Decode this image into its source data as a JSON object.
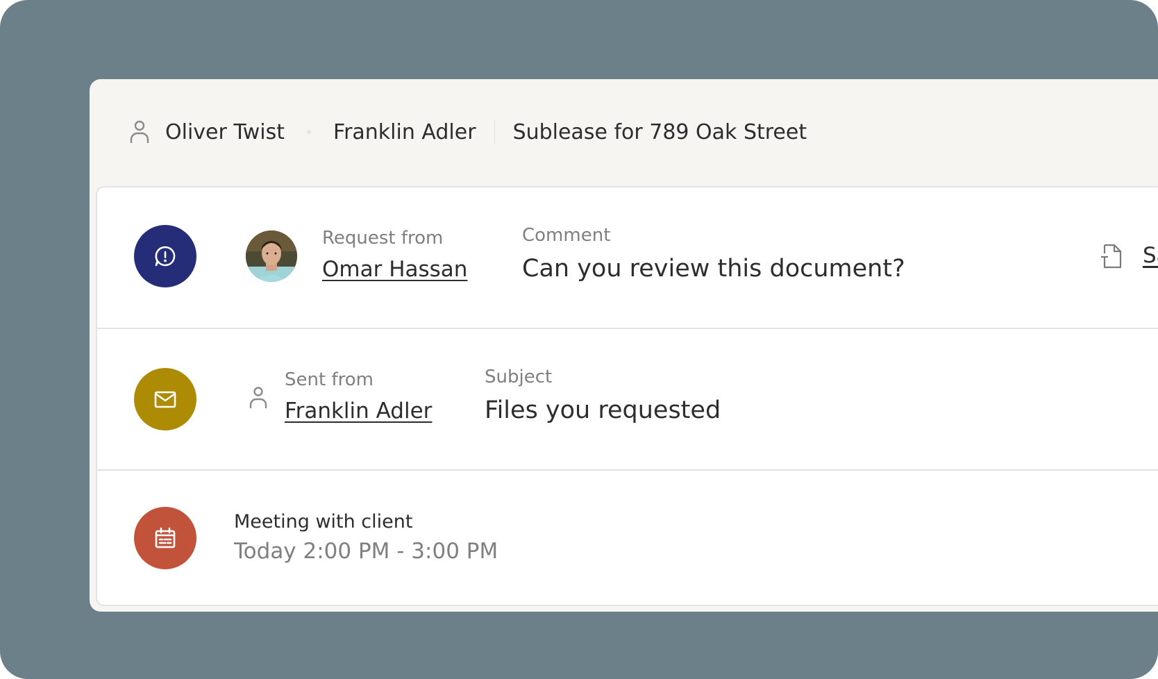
{
  "breadcrumb": {
    "icon": "person-icon",
    "items": [
      "Oliver Twist",
      "Franklin Adler",
      "Sublease for 789 Oak Street"
    ]
  },
  "activities": [
    {
      "icon": "comment-alert-icon",
      "color": "#262d78",
      "from_label": "Request from",
      "from_name": "Omar Hassan",
      "field_label": "Comment",
      "field_value": "Can you review this document?",
      "attachment_icon": "document-icon",
      "attachment_label": "Sa"
    },
    {
      "icon": "mail-icon",
      "color": "#ad8b04",
      "from_label": "Sent from",
      "from_name": "Franklin Adler",
      "field_label": "Subject",
      "field_value": "Files you requested"
    },
    {
      "icon": "calendar-icon",
      "color": "#c2533b",
      "title": "Meeting with client",
      "time": "Today 2:00 PM - 3:00 PM"
    }
  ]
}
